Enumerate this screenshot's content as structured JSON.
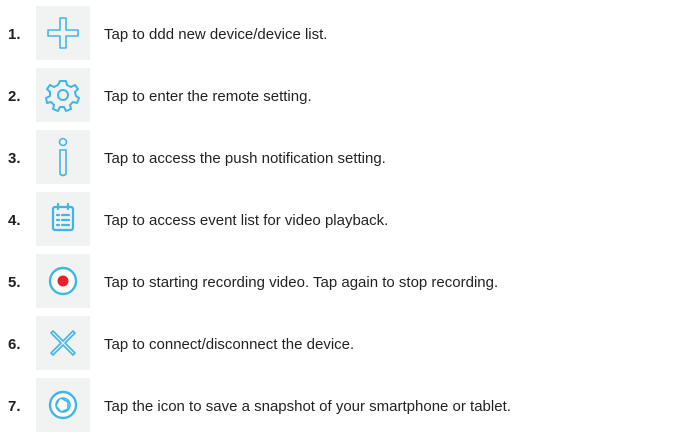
{
  "accent_color": "#41b6e6",
  "record_color": "#e8202a",
  "items": [
    {
      "number": "1.",
      "icon": "add-icon",
      "text": "Tap to ddd new device/device list."
    },
    {
      "number": "2.",
      "icon": "gear-icon",
      "text": "Tap to enter the remote setting."
    },
    {
      "number": "3.",
      "icon": "info-icon",
      "text": "Tap to access the push notification setting."
    },
    {
      "number": "4.",
      "icon": "event-list-icon",
      "text": "Tap to access event list for video playback."
    },
    {
      "number": "5.",
      "icon": "record-icon",
      "text": "Tap to starting recording video. Tap again to stop recording."
    },
    {
      "number": "6.",
      "icon": "disconnect-icon",
      "text": "Tap to connect/disconnect the device."
    },
    {
      "number": "7.",
      "icon": "snapshot-icon",
      "text": "Tap the icon to save a snapshot of your smartphone or tablet."
    }
  ]
}
